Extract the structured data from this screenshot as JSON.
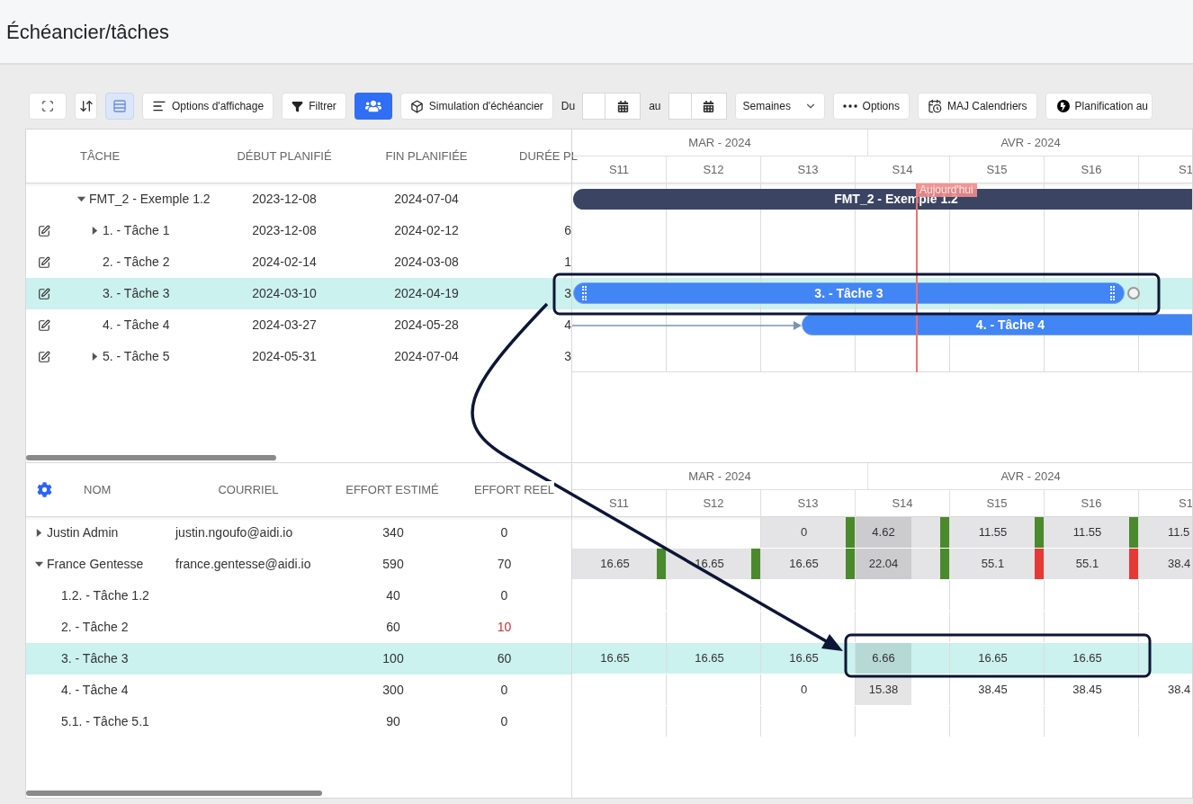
{
  "header": {
    "title": "Échéancier/tâches"
  },
  "toolbar": [
    {
      "kind": "icon",
      "selected": false
    },
    {
      "kind": "icon",
      "selected": false
    },
    {
      "kind": "icon",
      "selected": true
    },
    {
      "kind": "button",
      "label": "Options d'affichage"
    },
    {
      "kind": "button",
      "label": "Filtrer"
    },
    {
      "kind": "primary"
    },
    {
      "kind": "button",
      "label": "Simulation d'échéancier"
    },
    {
      "kind": "date",
      "label": "Du"
    },
    {
      "kind": "date",
      "label": "au"
    },
    {
      "kind": "select",
      "label": "Semaines"
    },
    {
      "kind": "button",
      "label": "Options"
    },
    {
      "kind": "button",
      "label": "MAJ Calendriers"
    },
    {
      "kind": "button",
      "label": "Planification au"
    }
  ],
  "tasks": {
    "columns": [
      "TÂCHE",
      "DÉBUT PLANIFIÉ",
      "FIN PLANIFIÉE",
      "DURÉE PL"
    ],
    "rows": [
      {
        "name": "FMT_2 - Exemple 1.2",
        "start": "2023-12-08",
        "end": "2024-07-04",
        "expanded": true,
        "selected": false,
        "bar": {
          "label": "FMT_2 - Exemple 1.2",
          "kind": "summary"
        },
        "children": [
          {
            "name": "1. - Tâche 1",
            "start": "2023-12-08",
            "end": "2024-02-12",
            "duration": "6",
            "expanded": false,
            "selected": false
          },
          {
            "name": "2. - Tâche 2",
            "start": "2024-02-14",
            "end": "2024-03-08",
            "duration": "1",
            "selected": false
          },
          {
            "name": "3. - Tâche 3",
            "start": "2024-03-10",
            "end": "2024-04-19",
            "duration": "3",
            "selected": true,
            "bar": {
              "label": "3. - Tâche 3",
              "kind": "task"
            }
          },
          {
            "name": "4. - Tâche 4",
            "start": "2024-03-27",
            "end": "2024-05-28",
            "duration": "4",
            "selected": false,
            "bar": {
              "label": "4. - Tâche 4",
              "kind": "task"
            }
          },
          {
            "name": "5. - Tâche 5",
            "start": "2024-05-31",
            "end": "2024-07-04",
            "duration": "3",
            "expanded": false,
            "selected": false
          }
        ]
      }
    ]
  },
  "timeline": {
    "months": [
      "MAR - 2024",
      "AVR - 2024"
    ],
    "weeks": [
      "S11",
      "S12",
      "S13",
      "S14",
      "S15",
      "S16",
      "S1"
    ],
    "today_label": "Aujourd'hui"
  },
  "resources": {
    "columns": [
      "NOM",
      "COURRIEL",
      "EFFORT ESTIMÉ",
      "EFFORT REEL"
    ],
    "rows": [
      {
        "name": "Justin Admin",
        "email": "justin.ngoufo@aidi.io",
        "estimated": "340",
        "actual": "0",
        "overrun": false,
        "expanded": false,
        "selected": false,
        "cells": [
          {},
          {},
          {
            "value": "0",
            "shaded": true,
            "partial": false,
            "color": "#4a8a2c"
          },
          {
            "value": "4.62",
            "shaded": true,
            "partial": true,
            "color": "#4a8a2c"
          },
          {
            "value": "11.55",
            "shaded": true,
            "partial": false,
            "color": "#4a8a2c"
          },
          {
            "value": "11.55",
            "shaded": true,
            "partial": false,
            "color": "#4a8a2c"
          },
          {
            "value": "11.5",
            "shaded": true,
            "partial": false
          }
        ]
      },
      {
        "name": "France Gentesse",
        "email": "france.gentesse@aidi.io",
        "estimated": "590",
        "actual": "70",
        "overrun": false,
        "expanded": true,
        "selected": false,
        "cells": [
          {
            "value": "16.65",
            "shaded": true,
            "partial": false,
            "color": "#4a8a2c"
          },
          {
            "value": "16.65",
            "shaded": true,
            "partial": false,
            "color": "#4a8a2c"
          },
          {
            "value": "16.65",
            "shaded": true,
            "partial": false,
            "color": "#4a8a2c"
          },
          {
            "value": "22.04",
            "shaded": true,
            "partial": true,
            "color": "#4a8a2c"
          },
          {
            "value": "55.1",
            "shaded": true,
            "partial": false,
            "color": "#e53935"
          },
          {
            "value": "55.1",
            "shaded": true,
            "partial": false,
            "color": "#e53935"
          },
          {
            "value": "38.4",
            "shaded": true,
            "partial": false
          }
        ],
        "children": [
          {
            "name": "1.2. - Tâche 1.2",
            "estimated": "40",
            "actual": "0",
            "overrun": false,
            "selected": false
          },
          {
            "name": "2. - Tâche 2",
            "estimated": "60",
            "actual": "10",
            "overrun": true,
            "selected": false
          },
          {
            "name": "3. - Tâche 3",
            "estimated": "100",
            "actual": "60",
            "overrun": false,
            "selected": true,
            "cells": [
              {
                "value": "16.65",
                "shaded": false,
                "partial": false
              },
              {
                "value": "16.65",
                "shaded": false,
                "partial": false
              },
              {
                "value": "16.65",
                "shaded": false,
                "partial": false
              },
              {
                "value": "6.66",
                "shaded": false,
                "partial": true
              },
              {
                "value": "16.65",
                "shaded": false,
                "partial": false
              },
              {
                "value": "16.65",
                "shaded": false,
                "partial": false
              },
              {}
            ]
          },
          {
            "name": "4. - Tâche 4",
            "estimated": "300",
            "actual": "0",
            "overrun": false,
            "selected": false,
            "cells": [
              {},
              {},
              {
                "value": "0",
                "shaded": false,
                "partial": false
              },
              {
                "value": "15.38",
                "shaded": false,
                "partial": true
              },
              {
                "value": "38.45",
                "shaded": false,
                "partial": false
              },
              {
                "value": "38.45",
                "shaded": false,
                "partial": false
              },
              {
                "value": "38.4",
                "shaded": false,
                "partial": false
              }
            ]
          },
          {
            "name": "5.1. - Tâche 5.1",
            "estimated": "90",
            "actual": "0",
            "overrun": false,
            "selected": false
          }
        ]
      }
    ]
  },
  "resource_timeline": {
    "months": [
      "MAR - 2024",
      "AVR - 2024"
    ],
    "weeks": [
      "S11",
      "S12",
      "S13",
      "S14",
      "S15",
      "S16",
      "S1"
    ]
  }
}
